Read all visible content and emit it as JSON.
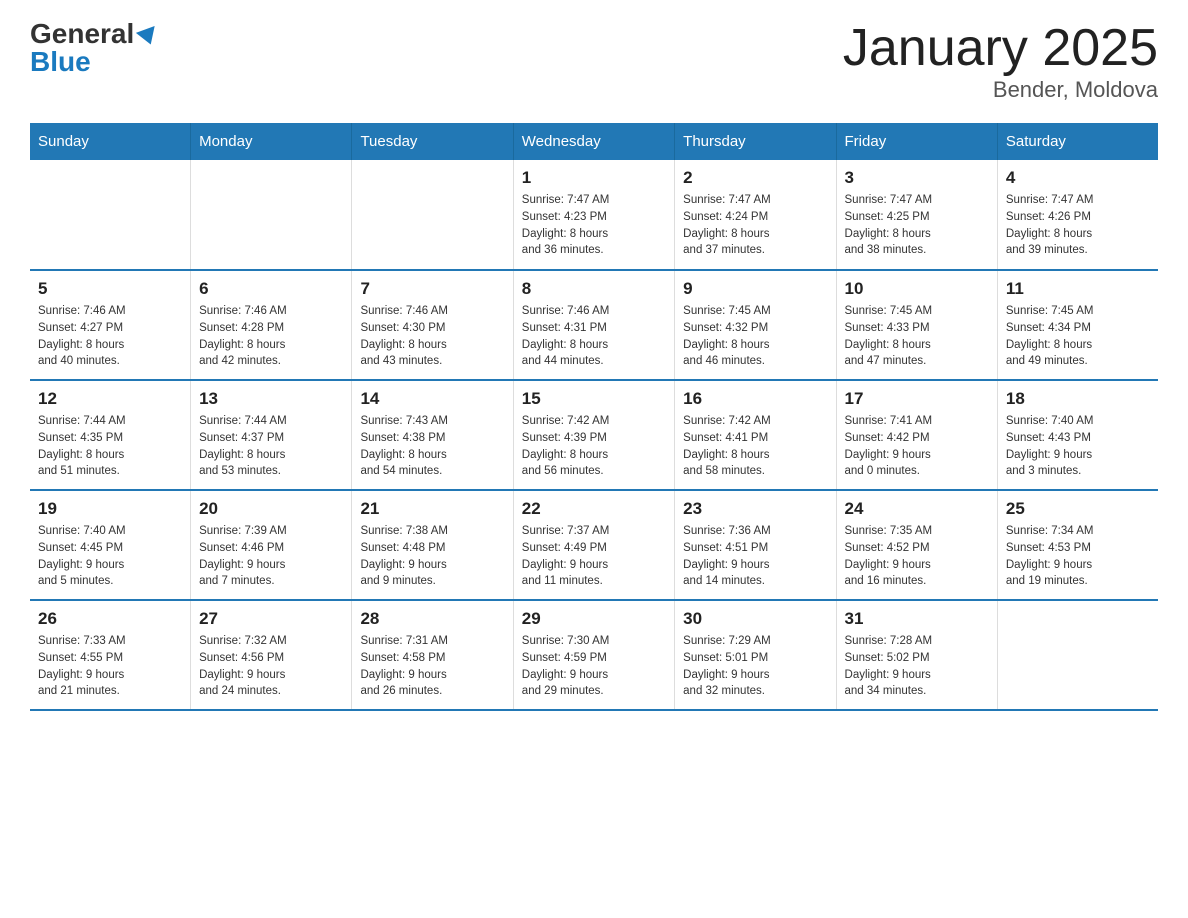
{
  "logo": {
    "general": "General",
    "blue": "Blue"
  },
  "title": "January 2025",
  "subtitle": "Bender, Moldova",
  "days_of_week": [
    "Sunday",
    "Monday",
    "Tuesday",
    "Wednesday",
    "Thursday",
    "Friday",
    "Saturday"
  ],
  "weeks": [
    [
      {
        "day": "",
        "info": ""
      },
      {
        "day": "",
        "info": ""
      },
      {
        "day": "",
        "info": ""
      },
      {
        "day": "1",
        "info": "Sunrise: 7:47 AM\nSunset: 4:23 PM\nDaylight: 8 hours\nand 36 minutes."
      },
      {
        "day": "2",
        "info": "Sunrise: 7:47 AM\nSunset: 4:24 PM\nDaylight: 8 hours\nand 37 minutes."
      },
      {
        "day": "3",
        "info": "Sunrise: 7:47 AM\nSunset: 4:25 PM\nDaylight: 8 hours\nand 38 minutes."
      },
      {
        "day": "4",
        "info": "Sunrise: 7:47 AM\nSunset: 4:26 PM\nDaylight: 8 hours\nand 39 minutes."
      }
    ],
    [
      {
        "day": "5",
        "info": "Sunrise: 7:46 AM\nSunset: 4:27 PM\nDaylight: 8 hours\nand 40 minutes."
      },
      {
        "day": "6",
        "info": "Sunrise: 7:46 AM\nSunset: 4:28 PM\nDaylight: 8 hours\nand 42 minutes."
      },
      {
        "day": "7",
        "info": "Sunrise: 7:46 AM\nSunset: 4:30 PM\nDaylight: 8 hours\nand 43 minutes."
      },
      {
        "day": "8",
        "info": "Sunrise: 7:46 AM\nSunset: 4:31 PM\nDaylight: 8 hours\nand 44 minutes."
      },
      {
        "day": "9",
        "info": "Sunrise: 7:45 AM\nSunset: 4:32 PM\nDaylight: 8 hours\nand 46 minutes."
      },
      {
        "day": "10",
        "info": "Sunrise: 7:45 AM\nSunset: 4:33 PM\nDaylight: 8 hours\nand 47 minutes."
      },
      {
        "day": "11",
        "info": "Sunrise: 7:45 AM\nSunset: 4:34 PM\nDaylight: 8 hours\nand 49 minutes."
      }
    ],
    [
      {
        "day": "12",
        "info": "Sunrise: 7:44 AM\nSunset: 4:35 PM\nDaylight: 8 hours\nand 51 minutes."
      },
      {
        "day": "13",
        "info": "Sunrise: 7:44 AM\nSunset: 4:37 PM\nDaylight: 8 hours\nand 53 minutes."
      },
      {
        "day": "14",
        "info": "Sunrise: 7:43 AM\nSunset: 4:38 PM\nDaylight: 8 hours\nand 54 minutes."
      },
      {
        "day": "15",
        "info": "Sunrise: 7:42 AM\nSunset: 4:39 PM\nDaylight: 8 hours\nand 56 minutes."
      },
      {
        "day": "16",
        "info": "Sunrise: 7:42 AM\nSunset: 4:41 PM\nDaylight: 8 hours\nand 58 minutes."
      },
      {
        "day": "17",
        "info": "Sunrise: 7:41 AM\nSunset: 4:42 PM\nDaylight: 9 hours\nand 0 minutes."
      },
      {
        "day": "18",
        "info": "Sunrise: 7:40 AM\nSunset: 4:43 PM\nDaylight: 9 hours\nand 3 minutes."
      }
    ],
    [
      {
        "day": "19",
        "info": "Sunrise: 7:40 AM\nSunset: 4:45 PM\nDaylight: 9 hours\nand 5 minutes."
      },
      {
        "day": "20",
        "info": "Sunrise: 7:39 AM\nSunset: 4:46 PM\nDaylight: 9 hours\nand 7 minutes."
      },
      {
        "day": "21",
        "info": "Sunrise: 7:38 AM\nSunset: 4:48 PM\nDaylight: 9 hours\nand 9 minutes."
      },
      {
        "day": "22",
        "info": "Sunrise: 7:37 AM\nSunset: 4:49 PM\nDaylight: 9 hours\nand 11 minutes."
      },
      {
        "day": "23",
        "info": "Sunrise: 7:36 AM\nSunset: 4:51 PM\nDaylight: 9 hours\nand 14 minutes."
      },
      {
        "day": "24",
        "info": "Sunrise: 7:35 AM\nSunset: 4:52 PM\nDaylight: 9 hours\nand 16 minutes."
      },
      {
        "day": "25",
        "info": "Sunrise: 7:34 AM\nSunset: 4:53 PM\nDaylight: 9 hours\nand 19 minutes."
      }
    ],
    [
      {
        "day": "26",
        "info": "Sunrise: 7:33 AM\nSunset: 4:55 PM\nDaylight: 9 hours\nand 21 minutes."
      },
      {
        "day": "27",
        "info": "Sunrise: 7:32 AM\nSunset: 4:56 PM\nDaylight: 9 hours\nand 24 minutes."
      },
      {
        "day": "28",
        "info": "Sunrise: 7:31 AM\nSunset: 4:58 PM\nDaylight: 9 hours\nand 26 minutes."
      },
      {
        "day": "29",
        "info": "Sunrise: 7:30 AM\nSunset: 4:59 PM\nDaylight: 9 hours\nand 29 minutes."
      },
      {
        "day": "30",
        "info": "Sunrise: 7:29 AM\nSunset: 5:01 PM\nDaylight: 9 hours\nand 32 minutes."
      },
      {
        "day": "31",
        "info": "Sunrise: 7:28 AM\nSunset: 5:02 PM\nDaylight: 9 hours\nand 34 minutes."
      },
      {
        "day": "",
        "info": ""
      }
    ]
  ]
}
